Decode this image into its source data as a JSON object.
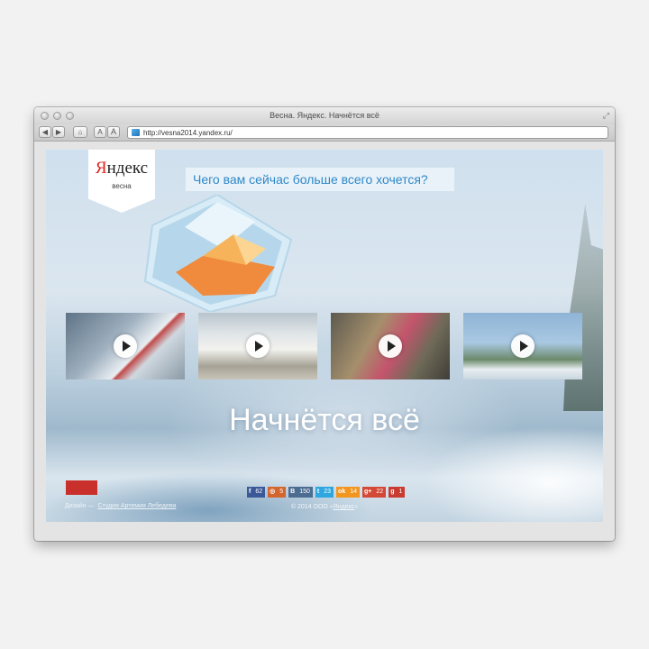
{
  "window": {
    "title": "Весна. Яндекс. Начнётся всё",
    "url": "http://vesna2014.yandex.ru/"
  },
  "toolbar": {
    "back_icon": "◀",
    "forward_icon": "▶",
    "home_icon": "⌂",
    "font_smaller": "A",
    "font_larger": "A"
  },
  "page": {
    "logo": {
      "brand_first": "Я",
      "brand_rest": "ндекс",
      "sub": "весна"
    },
    "question": "Чего вам сейчас больше всего хочется?",
    "headline": "Начнётся всё",
    "videos": [
      {
        "name": "video-1"
      },
      {
        "name": "video-2"
      },
      {
        "name": "video-3"
      },
      {
        "name": "video-4"
      }
    ],
    "footer": {
      "design_label": "Дизайн —",
      "design_link": "Студия Артемия Лебедева",
      "copyright": "© 2014 ООО «",
      "copyright_link": "Яндекс",
      "copyright_end": "»"
    },
    "social": [
      {
        "icon": "f",
        "count": "62",
        "color": "#3b5998"
      },
      {
        "icon": "◎",
        "count": "5",
        "color": "#d3662f"
      },
      {
        "icon": "B",
        "count": "150",
        "color": "#4c6c91"
      },
      {
        "icon": "t",
        "count": "23",
        "color": "#2ea7e0"
      },
      {
        "icon": "ok",
        "count": "14",
        "color": "#f29620"
      },
      {
        "icon": "g+",
        "count": "22",
        "color": "#d34836"
      },
      {
        "icon": "g",
        "count": "1",
        "color": "#c93b31"
      }
    ]
  }
}
